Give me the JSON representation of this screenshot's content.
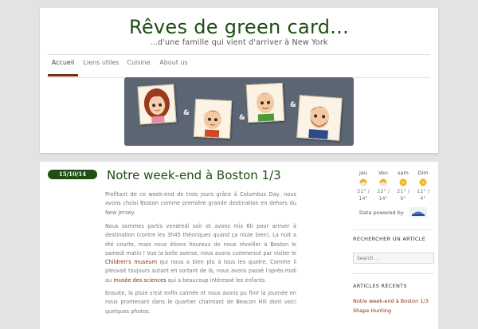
{
  "site": {
    "title": "Rêves de green card...",
    "tagline": "...d'une famille qui vient d'arriver à New York"
  },
  "nav": {
    "items": [
      {
        "label": "Accueil",
        "active": true
      },
      {
        "label": "Liens utiles",
        "active": false
      },
      {
        "label": "Cuisine",
        "active": false
      },
      {
        "label": "About us",
        "active": false
      }
    ]
  },
  "banner": {
    "amp1": "&",
    "amp2": "&",
    "amp3": "&"
  },
  "post": {
    "date": "15/10/14",
    "title": "Notre week-end à Boston 1/3",
    "p1": "Profitant de ce week-end de trois jours grâce à Columbus Day, nous avons choisi Boston comme première grande destination en dehors du New Jersey.",
    "p2_a": "Nous sommes partis vendredi soir et avons mis 6h pour arriver à destination (contre les 3h45 théoriques quand ça roule bien). La nuit a été courte, mais nous étions heureux de nous réveiller à Boston le samedi matin ! Vue la belle averse, nous avons commencé par visiter le ",
    "p2_link1": "Children's museum",
    "p2_b": " qui nous a bien plu à tous les quatre. Comme il pleuvait toujours autant en sortant de là, nous avons passé l'après-midi au ",
    "p2_link2": "musée des sciences",
    "p2_c": " qui a beaucoup intéressé les enfants.",
    "p3": "Ensuite, la pluie s'est enfin calmée et nous avons pu finir la journée en nous promenant dans le quartier charmant de Beacon Hill dont voici quelques photos."
  },
  "weather": {
    "days": [
      {
        "day": "jeu",
        "high": "21°",
        "low": "14°",
        "icon": "sun-cloud-icon"
      },
      {
        "day": "Ven",
        "high": "22°",
        "low": "14°",
        "icon": "sun-cloud-icon"
      },
      {
        "day": "sam",
        "high": "21°",
        "low": "9°",
        "icon": "sun-icon"
      },
      {
        "day": "Dim",
        "high": "12°",
        "low": "4°",
        "icon": "sun-icon"
      }
    ],
    "powered_by": "Data powered by"
  },
  "sidebar": {
    "search_title": "RECHERCHER UN ARTICLE",
    "search_placeholder": "Search ...",
    "recent_title": "ARTICLES RÉCENTS",
    "recent_items": [
      "Notre week-end à Boston 1/3",
      "Shape Hunting"
    ]
  },
  "colors": {
    "accent": "#1e4d12",
    "link": "#8b2e0c",
    "banner_bg": "#5b6573"
  }
}
